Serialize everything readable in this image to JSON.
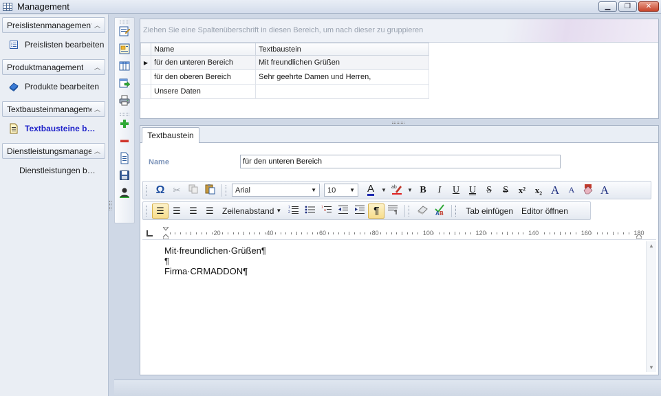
{
  "window": {
    "title": "Management"
  },
  "window_buttons": {
    "minimize": "▁",
    "restore": "❐",
    "close": "✕"
  },
  "nav": {
    "groups": [
      {
        "header": "Preislistenmanagement",
        "items": [
          {
            "label": "Preislisten bearbeiten",
            "icon": "list-icon",
            "active": false
          }
        ]
      },
      {
        "header": "Produktmanagement",
        "items": [
          {
            "label": "Produkte bearbeiten",
            "icon": "product-icon",
            "active": false
          }
        ]
      },
      {
        "header": "Textbausteinmanagement",
        "items": [
          {
            "label": "Textbausteine bearbeiten",
            "icon": "note-icon",
            "active": true
          }
        ]
      },
      {
        "header": "Dienstleistungsmanagement",
        "items": [
          {
            "label": "Dienstleistungen bearbeiten",
            "icon": "",
            "active": false
          }
        ]
      }
    ]
  },
  "grid": {
    "group_hint": "Ziehen Sie eine Spaltenüberschrift in diesen Bereich, um nach dieser zu gruppieren",
    "columns": [
      "Name",
      "Textbaustein"
    ],
    "rows": [
      {
        "name": "für den unteren Bereich",
        "text": "Mit freundlichen Grüßen",
        "selected": true
      },
      {
        "name": "für den oberen Bereich",
        "text": "Sehr geehrte Damen und Herren,",
        "selected": false
      },
      {
        "name": "Unsere Daten",
        "text": "",
        "selected": false
      }
    ]
  },
  "editor": {
    "tab_label": "Textbaustein",
    "name_label": "Name",
    "name_value": "für den unteren Bereich",
    "toolbar": {
      "font": "Arial",
      "size": "10",
      "bold": "B",
      "italic": "I",
      "underline": "U",
      "double_underline": "U",
      "strike": "S",
      "double_strike": "S",
      "superscript": "x²",
      "subscript": "x₂",
      "grow_font": "A",
      "shrink_font": "A",
      "font_dialog": "A",
      "line_spacing": "Zeilenabstand",
      "paragraph_marks": "¶",
      "tab_insert": "Tab einfügen",
      "editor_open": "Editor öffnen"
    },
    "ruler": {
      "labels": [
        "20",
        "40",
        "60",
        "80",
        "100",
        "120",
        "140",
        "160",
        "180"
      ]
    },
    "document_lines": [
      "Mit·freundlichen·Grüßen¶",
      "¶",
      "Firma·CRMADDON¶"
    ]
  },
  "colors": {
    "active_nav": "#1f23c9",
    "name_label": "#7c93b9",
    "pressed_button": "#f7dd8d"
  }
}
